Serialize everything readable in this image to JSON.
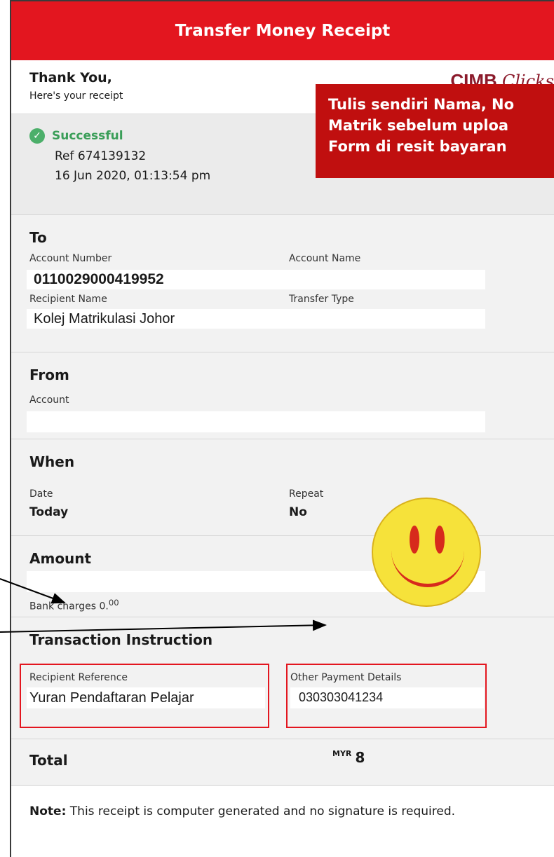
{
  "header": {
    "title": "Transfer Money Receipt"
  },
  "greeting": {
    "thanks": "Thank You,",
    "subtitle": "Here's your receipt"
  },
  "logo": {
    "brand": "CIMB",
    "script": "Clicks"
  },
  "overlay": {
    "lines": [
      "Tulis sendiri Nama, No",
      "Matrik sebelum uploa",
      "Form di resit bayaran"
    ]
  },
  "status": {
    "label": "Successful",
    "ref": "Ref 674139132",
    "date": "16 Jun 2020, 01:13:54 pm"
  },
  "to": {
    "heading": "To",
    "account_number_label": "Account Number",
    "account_number": "0110029000419952",
    "account_name_label": "Account Name",
    "recipient_name_label": "Recipient Name",
    "recipient_name": "Kolej Matrikulasi Johor",
    "transfer_type_label": "Transfer Type"
  },
  "from": {
    "heading": "From",
    "account_label": "Account"
  },
  "when": {
    "heading": "When",
    "date_label": "Date",
    "date_value": "Today",
    "repeat_label": "Repeat",
    "repeat_value": "No"
  },
  "amount": {
    "heading": "Amount",
    "bank_charges": "Bank charges  0.",
    "bank_charges_sup": "00"
  },
  "instruction": {
    "heading": "Transaction Instruction",
    "recipient_reference_label": "Recipient Reference",
    "recipient_reference": "Yuran Pendaftaran Pelajar",
    "other_details_label": "Other Payment Details",
    "other_details": "030303041234"
  },
  "total": {
    "label": "Total",
    "currency": "MYR",
    "amount_partial": "8"
  },
  "note": {
    "bold": "Note:",
    "text": " This receipt is computer generated and no signature is required."
  }
}
